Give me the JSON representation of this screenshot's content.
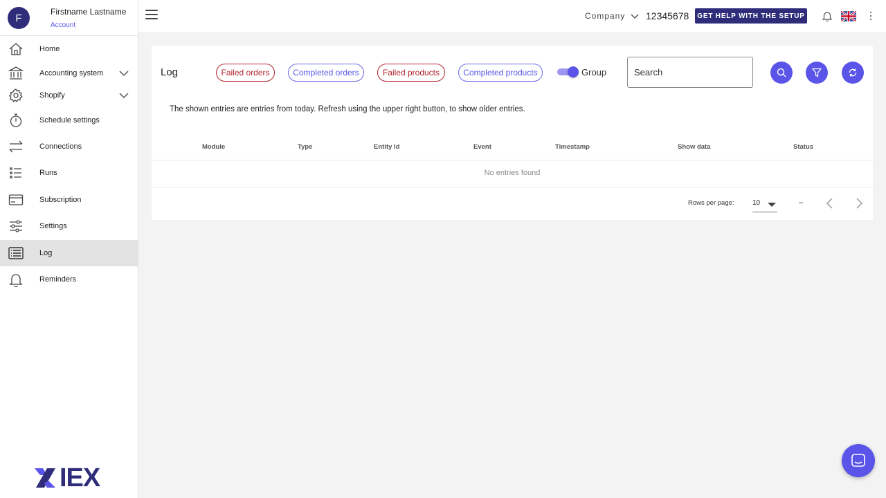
{
  "profile": {
    "initial": "F",
    "name": "Firstname Lastname",
    "account_link": "Account"
  },
  "sidebar": {
    "items": [
      {
        "label": "Home",
        "icon": "home-icon"
      },
      {
        "label": "Accounting system",
        "icon": "bank-icon",
        "expandable": true
      },
      {
        "label": "Shopify",
        "icon": "gear-icon",
        "expandable": true
      },
      {
        "label": "Schedule settings",
        "icon": "stopwatch-icon"
      },
      {
        "label": "Connections",
        "icon": "swap-arrows-icon"
      },
      {
        "label": "Runs",
        "icon": "list-icon"
      },
      {
        "label": "Subscription",
        "icon": "credit-card-icon"
      },
      {
        "label": "Settings",
        "icon": "sliders-icon"
      },
      {
        "label": "Log",
        "icon": "log-list-icon",
        "active": true
      },
      {
        "label": "Reminders",
        "icon": "bell-icon"
      }
    ],
    "logo_text": "IEX"
  },
  "header": {
    "company_label": "Company",
    "company_id": "12345678",
    "help_button": "GET HELP WITH THE SETUP",
    "language": "en-GB flag"
  },
  "log": {
    "title": "Log",
    "filters": [
      {
        "label": "Failed orders",
        "style": "red"
      },
      {
        "label": "Completed orders",
        "style": "blue"
      },
      {
        "label": "Failed products",
        "style": "red"
      },
      {
        "label": "Completed products",
        "style": "blue"
      }
    ],
    "group_toggle": {
      "label": "Group",
      "on": true
    },
    "search": {
      "placeholder": "Search",
      "value": ""
    },
    "info_text": "The shown entries are entries from today. Refresh using the upper right button, to show older entries.",
    "table": {
      "columns": [
        "Module",
        "Type",
        "Entity Id",
        "Event",
        "Timestamp",
        "Show data",
        "Status"
      ],
      "rows": [],
      "empty_text": "No entries found"
    },
    "pagination": {
      "rows_per_page_label": "Rows per page:",
      "rows_per_page": "10",
      "range": "–"
    }
  },
  "colors": {
    "brand": "#2f2d7a",
    "accent": "#5a55e8",
    "danger": "#b3232f"
  }
}
